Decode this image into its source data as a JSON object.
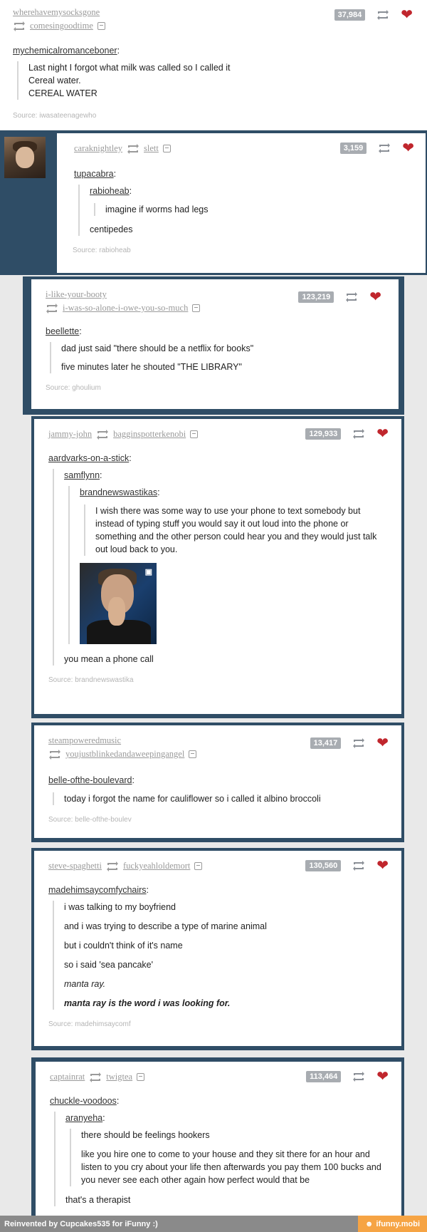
{
  "posts": [
    {
      "user": "wherehavemysocksgone",
      "reblog": "comesingoodtime",
      "count": "37,984",
      "poster": "mychemicalromanceboner",
      "lines": [
        "Last night I forgot what milk was called so I called it",
        "Cereal water.",
        "CEREAL WATER"
      ],
      "source": "Source: iwasateenagewho"
    },
    {
      "user": "caraknightley",
      "reblog": "slett",
      "count": "3,159",
      "poster": "tupacabra",
      "nested_poster": "rabioheab",
      "nested_line": "imagine if worms had legs",
      "reply": "centipedes",
      "source": "Source: rabioheab"
    },
    {
      "user": "i-like-your-booty",
      "reblog": "i-was-so-alone-i-owe-you-so-much",
      "count": "123,219",
      "poster": "beellette",
      "lines": [
        "dad just said \"there should be a netflix for books\"",
        "five minutes later he shouted \"THE LIBRARY\""
      ],
      "source": "Source: ghoulium"
    },
    {
      "user": "jammy-john",
      "reblog": "bagginspotterkenobi",
      "count": "129,933",
      "poster": "aardvarks-on-a-stick",
      "nested_poster": "samflynn",
      "inner_poster": "brandnewswastikas",
      "inner_text": "I wish there was some way to use your phone to text somebody but instead of typing stuff you would say it out loud into the phone or something and the other person could hear you and they would just talk out loud back to you.",
      "reply": "you mean a phone call",
      "source": "Source: brandnewswastika"
    },
    {
      "user": "steampoweredmusic",
      "reblog": "youjustblinkedandaweepingangel",
      "count": "13,417",
      "poster": "belle-ofthe-boulevard",
      "lines": [
        "today i forgot the name for cauliflower so i called it albino broccoli"
      ],
      "source": "Source: belle-ofthe-boulev"
    },
    {
      "user": "steve-spaghetti",
      "reblog": "fuckyeahloldemort",
      "count": "130,560",
      "poster": "madehimsaycomfychairs",
      "lines": [
        "i was talking to my boyfriend",
        "and i was trying to describe a type of marine animal",
        "but i couldn't think of it's name",
        "so i said 'sea pancake'"
      ],
      "italic_line": "manta ray.",
      "bold_line": "manta ray is the word i was looking for.",
      "source": "Source: madehimsaycomf"
    },
    {
      "user": "captainrat",
      "reblog": "twigtea",
      "count": "113,464",
      "poster": "chuckle-voodoos",
      "nested_poster": "aranyeha",
      "lines": [
        "there should be feelings hookers",
        "like you hire one to come to your house and they sit there for an hour and listen to you cry about your life then afterwards you pay them 100 bucks and you never see each other again how perfect would that be"
      ],
      "reply": "that's a therapist"
    }
  ],
  "footer": {
    "text": "Reinvented by Cupcakes535 for iFunny :)",
    "brand": "ifunny.mobi"
  },
  "colors": {
    "heart": "#c0262d",
    "dark_band": "#2f4d66",
    "brand": "#f6a444"
  }
}
